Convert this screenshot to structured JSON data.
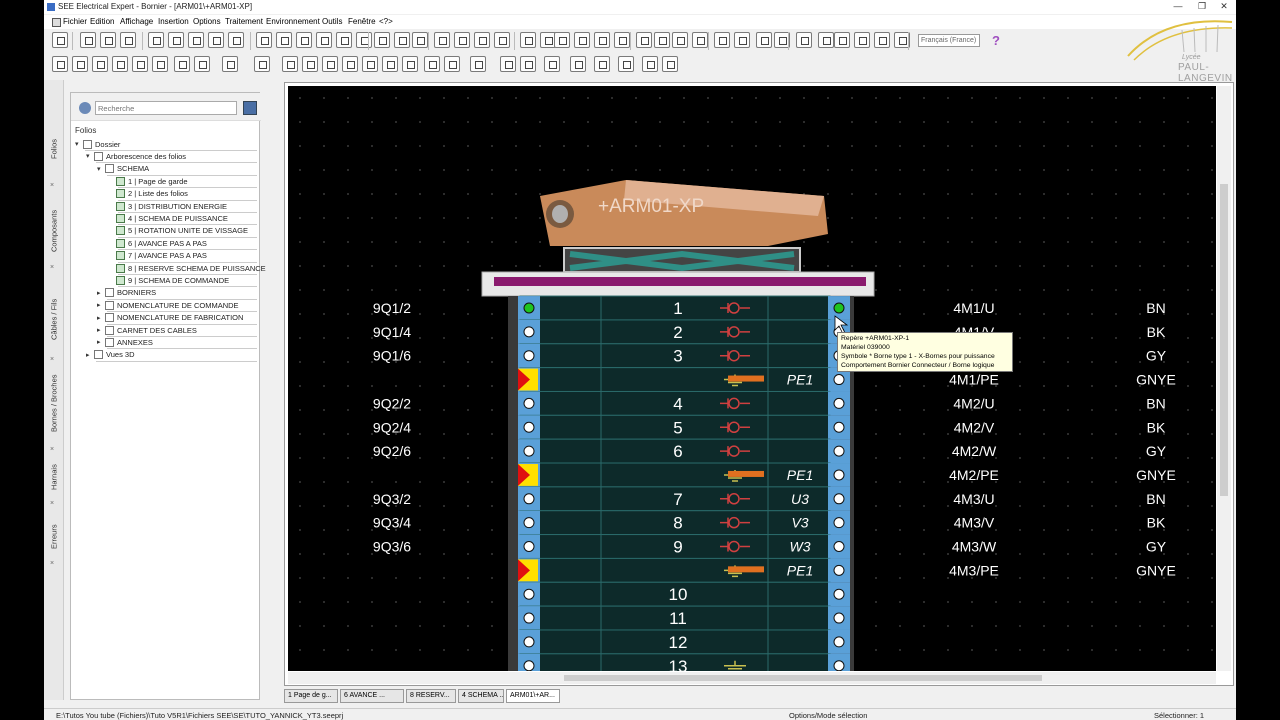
{
  "window": {
    "title": "SEE Electrical Expert - Bornier - [ARM01\\+ARM01-XP]",
    "controls": [
      "—",
      "❐",
      "✕"
    ]
  },
  "menu": [
    "Fichier",
    "Edition",
    "Affichage",
    "Insertion",
    "Options",
    "Traitement",
    "Environnement",
    "Outils",
    "Fenêtre",
    "<?>"
  ],
  "toolbar": {
    "language": "Français (France)",
    "help_label": "?"
  },
  "logo": {
    "line1": "Lycée",
    "line2": "PAUL-LANGEVIN"
  },
  "side_tabs": [
    "Folios",
    "Composants",
    "Câbles / Fils",
    "Bornes / Broches",
    "Harnais",
    "Erreurs"
  ],
  "panel": {
    "search_placeholder": "Recherche",
    "section_label": "Folios",
    "tree": [
      {
        "label": "Dossier",
        "level": 0,
        "expanded": true
      },
      {
        "label": "Arborescence des folios",
        "level": 1,
        "expanded": true
      },
      {
        "label": "SCHEMA",
        "level": 2,
        "expanded": true
      },
      {
        "label": "1 | Page de garde",
        "level": 3,
        "page": true
      },
      {
        "label": "2 | Liste des folios",
        "level": 3,
        "page": true
      },
      {
        "label": "3 | DISTRIBUTION ENERGIE",
        "level": 3,
        "page": true
      },
      {
        "label": "4 | SCHEMA DE PUISSANCE",
        "level": 3,
        "page": true
      },
      {
        "label": "5 | ROTATION UNITE DE VISSAGE",
        "level": 3,
        "page": true
      },
      {
        "label": "6 | AVANCE PAS A PAS",
        "level": 3,
        "page": true
      },
      {
        "label": "7 | AVANCE PAS A PAS",
        "level": 3,
        "page": true
      },
      {
        "label": "8 | RESERVE SCHEMA DE PUISSANCE",
        "level": 3,
        "page": true
      },
      {
        "label": "9 | SCHEMA DE COMMANDE",
        "level": 3,
        "page": true
      },
      {
        "label": "BORNIERS",
        "level": 2,
        "expanded": false
      },
      {
        "label": "NOMENCLATURE DE COMMANDE",
        "level": 2,
        "expanded": false
      },
      {
        "label": "NOMENCLATURE DE FABRICATION",
        "level": 2,
        "expanded": false
      },
      {
        "label": "CARNET DES CABLES",
        "level": 2,
        "expanded": false
      },
      {
        "label": "ANNEXES",
        "level": 2,
        "expanded": false
      },
      {
        "label": "Vues 3D",
        "level": 1,
        "expanded": false
      }
    ]
  },
  "drawing": {
    "header_label": "+ARM01-XP",
    "rows": [
      {
        "src": "9Q1/2",
        "num": "1",
        "type": "power",
        "mid": "",
        "dst": "4M1/U",
        "color": "BN",
        "marker": "green"
      },
      {
        "src": "9Q1/4",
        "num": "2",
        "type": "power",
        "mid": "",
        "dst": "4M1/V",
        "color": "BK",
        "marker": "circle"
      },
      {
        "src": "9Q1/6",
        "num": "3",
        "type": "power",
        "mid": "",
        "dst": "4M1/W",
        "color": "GY",
        "marker": "circle"
      },
      {
        "src": "",
        "num": "",
        "type": "earth",
        "mid": "PE1",
        "dst": "4M1/PE",
        "color": "GNYE",
        "marker": "flag"
      },
      {
        "src": "9Q2/2",
        "num": "4",
        "type": "power",
        "mid": "",
        "dst": "4M2/U",
        "color": "BN",
        "marker": "circle"
      },
      {
        "src": "9Q2/4",
        "num": "5",
        "type": "power",
        "mid": "",
        "dst": "4M2/V",
        "color": "BK",
        "marker": "circle"
      },
      {
        "src": "9Q2/6",
        "num": "6",
        "type": "power",
        "mid": "",
        "dst": "4M2/W",
        "color": "GY",
        "marker": "circle"
      },
      {
        "src": "",
        "num": "",
        "type": "earth",
        "mid": "PE1",
        "dst": "4M2/PE",
        "color": "GNYE",
        "marker": "flag"
      },
      {
        "src": "9Q3/2",
        "num": "7",
        "type": "power",
        "mid": "U3",
        "dst": "4M3/U",
        "color": "BN",
        "marker": "circle"
      },
      {
        "src": "9Q3/4",
        "num": "8",
        "type": "power",
        "mid": "V3",
        "dst": "4M3/V",
        "color": "BK",
        "marker": "circle"
      },
      {
        "src": "9Q3/6",
        "num": "9",
        "type": "power",
        "mid": "W3",
        "dst": "4M3/W",
        "color": "GY",
        "marker": "circle"
      },
      {
        "src": "",
        "num": "",
        "type": "earth",
        "mid": "PE1",
        "dst": "4M3/PE",
        "color": "GNYE",
        "marker": "flag"
      },
      {
        "src": "",
        "num": "10",
        "type": "empty",
        "mid": "",
        "dst": "",
        "color": "",
        "marker": "circle"
      },
      {
        "src": "",
        "num": "11",
        "type": "empty",
        "mid": "",
        "dst": "",
        "color": "",
        "marker": "circle"
      },
      {
        "src": "",
        "num": "12",
        "type": "empty",
        "mid": "",
        "dst": "",
        "color": "",
        "marker": "circle"
      },
      {
        "src": "",
        "num": "13",
        "type": "earth-only",
        "mid": "",
        "dst": "",
        "color": "",
        "marker": "circle"
      }
    ],
    "tooltip": [
      "Repère  +ARM01-XP-1",
      "Matériel  039000",
      "Symbole  * Borne type 1 - X-Bornes pour puissance",
      "Comportement  Bornier  Connecteur / Borne logique"
    ]
  },
  "doc_tabs": [
    "1 Page de g...",
    "6 AVANCE ...",
    "8 RESERV...",
    "4 SCHEMA ...",
    "ARM01\\+AR..."
  ],
  "status": {
    "path": "E:\\Tutos You tube (Fichiers)\\Tuto V5R1\\Fichiers SEE\\SE\\TUTO_YANNICK_YT3.seeprj",
    "mode": "Options/Mode sélection",
    "selection": "Sélectionner: 1"
  },
  "colors": {
    "terminal_blue": "#5aa0d8",
    "terminal_row": "#0d2a2a",
    "earth_bar": "#e07020",
    "symbol_red": "#d04040",
    "magenta_bar": "#8a1a6e"
  }
}
